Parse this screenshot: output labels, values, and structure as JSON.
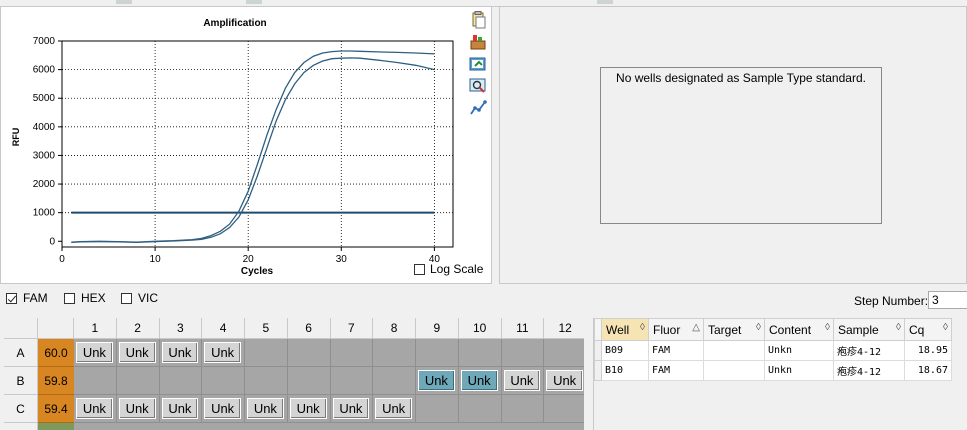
{
  "chart": {
    "title": "Amplification",
    "xlabel": "Cycles",
    "ylabel": "RFU",
    "log_scale_label": "Log Scale",
    "log_scale_checked": false
  },
  "chart_data": {
    "type": "line",
    "title": "Amplification",
    "xlabel": "Cycles",
    "ylabel": "RFU",
    "xlim": [
      0,
      42
    ],
    "ylim": [
      -200,
      7000
    ],
    "xticks": [
      0,
      10,
      20,
      30,
      40
    ],
    "yticks": [
      0,
      1000,
      2000,
      3000,
      4000,
      5000,
      6000,
      7000
    ],
    "grid": true,
    "threshold": 1000,
    "series": [
      {
        "x": [
          1,
          2,
          4,
          6,
          8,
          10,
          12,
          14,
          15,
          16,
          17,
          18,
          19,
          20,
          21,
          22,
          23,
          24,
          25,
          26,
          27,
          28,
          29,
          30,
          31,
          32,
          34,
          36,
          38,
          40
        ],
        "values": [
          -40,
          -20,
          -10,
          -20,
          -40,
          -10,
          10,
          40,
          70,
          140,
          260,
          480,
          850,
          1450,
          2300,
          3250,
          4200,
          4950,
          5500,
          5900,
          6150,
          6300,
          6380,
          6400,
          6410,
          6400,
          6330,
          6250,
          6150,
          6000
        ]
      },
      {
        "x": [
          1,
          2,
          4,
          6,
          8,
          10,
          12,
          14,
          15,
          16,
          17,
          18,
          19,
          20,
          21,
          22,
          23,
          24,
          25,
          26,
          27,
          28,
          29,
          30,
          31,
          32,
          34,
          36,
          38,
          40
        ],
        "values": [
          -30,
          -10,
          0,
          -10,
          -30,
          0,
          20,
          60,
          100,
          200,
          350,
          600,
          1050,
          1750,
          2700,
          3700,
          4600,
          5350,
          5900,
          6250,
          6470,
          6580,
          6630,
          6650,
          6650,
          6640,
          6620,
          6600,
          6580,
          6550
        ]
      }
    ]
  },
  "standard_curve": {
    "message": "No wells designated as Sample Type standard."
  },
  "fluors": [
    {
      "label": "FAM",
      "checked": true
    },
    {
      "label": "HEX",
      "checked": false
    },
    {
      "label": "VIC",
      "checked": false
    }
  ],
  "step": {
    "label": "Step Number:",
    "value": "3"
  },
  "plate": {
    "columns": [
      "1",
      "2",
      "3",
      "4",
      "5",
      "6",
      "7",
      "8",
      "9",
      "10",
      "11",
      "12"
    ],
    "rows": [
      {
        "label": "A",
        "temp": "60.0",
        "wells": [
          "Unk",
          "Unk",
          "Unk",
          "Unk",
          "",
          "",
          "",
          "",
          "",
          "",
          "",
          ""
        ],
        "selected": []
      },
      {
        "label": "B",
        "temp": "59.8",
        "wells": [
          "",
          "",
          "",
          "",
          "",
          "",
          "",
          "",
          "Unk",
          "Unk",
          "Unk",
          "Unk"
        ],
        "selected": [
          8,
          9
        ]
      },
      {
        "label": "C",
        "temp": "59.4",
        "wells": [
          "Unk",
          "Unk",
          "Unk",
          "Unk",
          "Unk",
          "Unk",
          "Unk",
          "Unk",
          "",
          "",
          "",
          ""
        ],
        "selected": []
      }
    ]
  },
  "results_table": {
    "headers": [
      "Well",
      "Fluor",
      "Target",
      "Content",
      "Sample",
      "Cq"
    ],
    "sorted_column": "Well",
    "rows": [
      {
        "Well": "B09",
        "Fluor": "FAM",
        "Target": "",
        "Content": "Unkn",
        "Sample": "疱疹4-12",
        "Cq": "18.95"
      },
      {
        "Well": "B10",
        "Fluor": "FAM",
        "Target": "",
        "Content": "Unkn",
        "Sample": "疱疹4-12",
        "Cq": "18.67"
      }
    ]
  },
  "icons": [
    "copy-icon",
    "export-icon",
    "save-image-icon",
    "zoom-icon",
    "chart-settings-icon"
  ]
}
